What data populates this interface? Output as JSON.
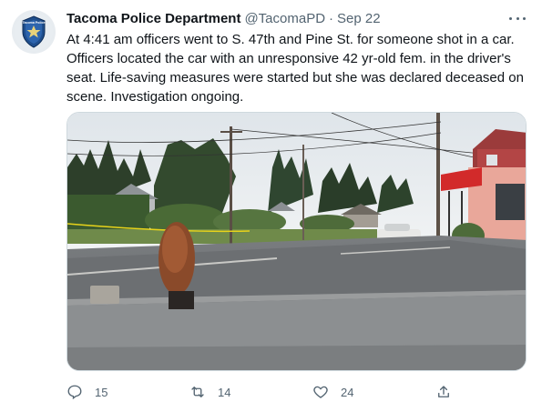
{
  "author": {
    "name": "Tacoma Police Department",
    "handle": "@TacomaPD",
    "separator": "·",
    "date": "Sep 22",
    "avatar_icon": "police-badge-icon",
    "avatar_text": "Tacoma Police"
  },
  "tweet": {
    "text": "At 4:41 am officers went to S. 47th and Pine St. for someone shot in a car. Officers located the car with an unresponsive 42 yr-old fem. in the driver's seat. Life-saving measures were started but she was declared deceased on scene. Investigation ongoing."
  },
  "actions": {
    "replies": "15",
    "retweets": "14",
    "likes": "24"
  },
  "icons": {
    "more": "more-options-icon",
    "reply": "reply-icon",
    "retweet": "retweet-icon",
    "like": "like-icon",
    "share": "share-icon"
  },
  "colors": {
    "text_primary": "#0f1419",
    "text_secondary": "#536471",
    "badge_blue": "#1f4e8c"
  }
}
